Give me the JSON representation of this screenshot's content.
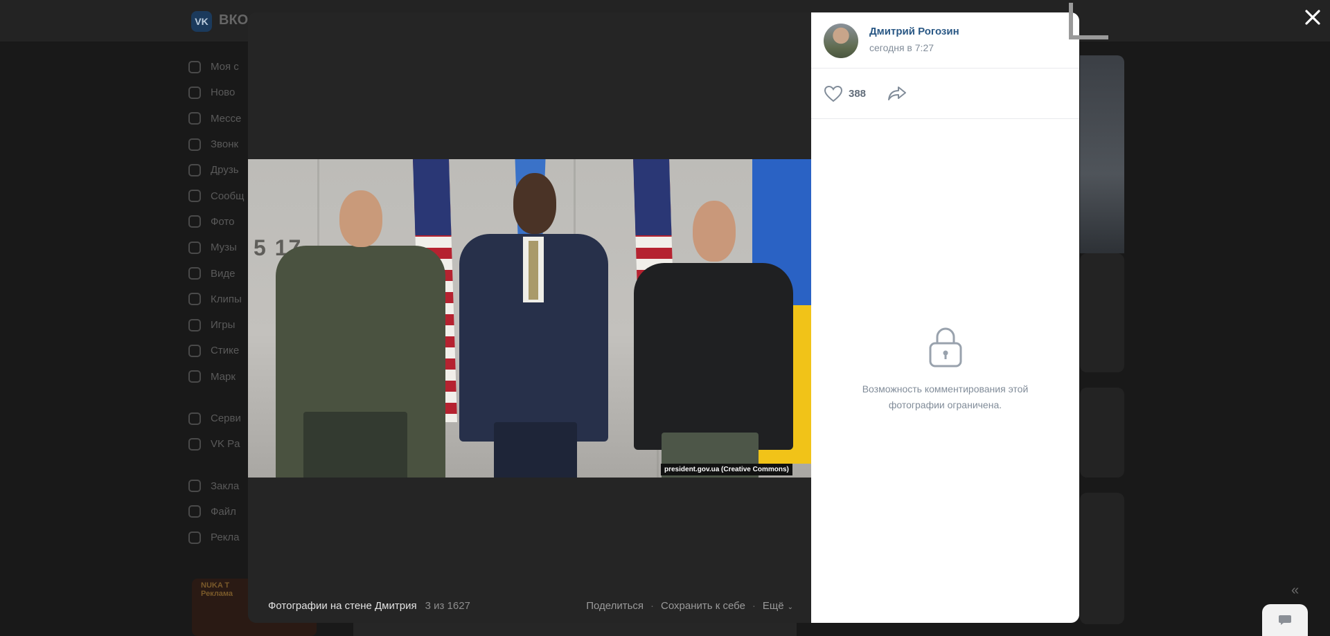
{
  "background": {
    "logo_text": "ВКО",
    "nav": [
      "Моя с",
      "Ново",
      "Мессе",
      "Звонк",
      "Друзь",
      "Сообщ",
      "Фото",
      "Музы",
      "Виде",
      "Клипы",
      "Игры",
      "Стике",
      "Марк",
      "Серви",
      "VK Pa",
      "Закла",
      "Файл",
      "Рекла"
    ],
    "ad_label": "NUKA T\nРеклама"
  },
  "viewer": {
    "photo_credit": "president.gov.ua (Creative Commons)",
    "wall_text": "5 17",
    "album_title": "Фотографии на стене Дмитрия",
    "counter": "3 из 1627",
    "share_label": "Поделиться",
    "save_label": "Сохранить к себе",
    "more_label": "Ещё",
    "separator": "·"
  },
  "panel": {
    "author_name": "Дмитрий Рогозин",
    "post_time": "сегодня в 7:27",
    "likes": "388",
    "comments_locked_text": "Возможность комментирования этой фотографии ограничена."
  },
  "icons": {
    "close": "close-icon",
    "like": "heart-icon",
    "share": "share-arrow-icon",
    "lock": "lock-icon",
    "chat": "chat-bubble-icon"
  },
  "colors": {
    "link": "#2a5885",
    "muted": "#818c99",
    "overlay": "#191919"
  }
}
